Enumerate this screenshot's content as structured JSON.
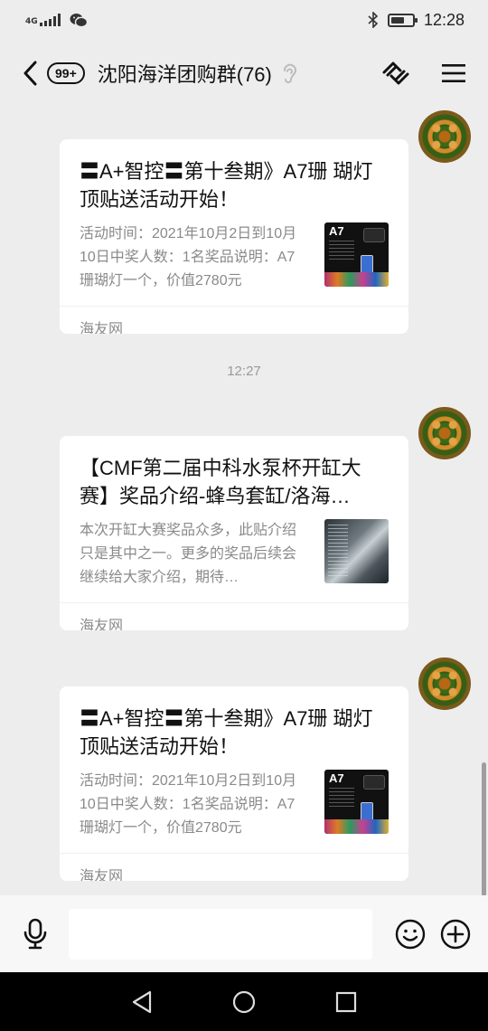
{
  "status_bar": {
    "network": "4G",
    "time": "12:28"
  },
  "header": {
    "unread_badge": "99+",
    "title": "沈阳海洋团购群(76)"
  },
  "messages": [
    {
      "title": "〓A+智控〓第十叁期》A7珊 瑚灯顶贴送活动开始！",
      "description": "活动时间：2021年10月2日到10月10日中奖人数：1名奖品说明：A7珊瑚灯一个，价值2780元",
      "source": "海友网",
      "thumb_label": "A7"
    },
    {
      "title": "【CMF第二届中科水泵杯开缸大赛】奖品介绍-蜂鸟套缸/洛海…",
      "description": "本次开缸大赛奖品众多，此贴介绍只是其中之一。更多的奖品后续会继续给大家介绍，期待…",
      "source": "海友网"
    },
    {
      "title": "〓A+智控〓第十叁期》A7珊 瑚灯顶贴送活动开始！",
      "description": "活动时间：2021年10月2日到10月10日中奖人数：1名奖品说明：A7珊瑚灯一个，价值2780元",
      "source": "海友网",
      "thumb_label": "A7"
    }
  ],
  "timestamp": "12:27",
  "input": {
    "placeholder": ""
  }
}
